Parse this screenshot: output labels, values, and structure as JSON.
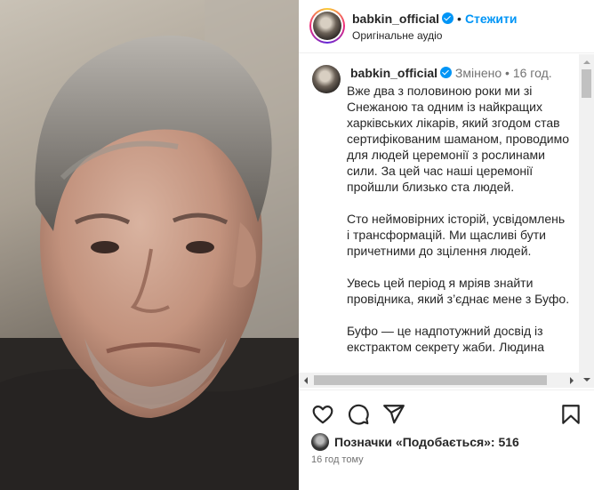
{
  "header": {
    "username": "babkin_official",
    "follow_label": "Стежити",
    "audio_label": "Оригінальне аудіо"
  },
  "caption": {
    "username": "babkin_official",
    "edited_label": "Змінено",
    "time": "16 год.",
    "text": "Вже два з половиною роки ми зі Снежаною та одним із найкращих харківських лікарів, який згодом став сертифікованим шаманом, проводимо для людей церемонії з рослинами сили. За цей час наші церемонії пройшли близько ста людей.\n\nСто неймовірних історій, усвідомлень і трансформацій. Ми щасливі бути причетними до зцілення людей.\n\nУвесь цей період я мріяв знайти провідника, який з’єднає мене з Буфо.\n\nБуфо — це надпотужний досвід із екстрактом секрету жаби. Людина"
  },
  "likes": {
    "text": "Позначки «Подобається»: 516"
  },
  "timestamp": "16 год тому",
  "colors": {
    "accent": "#0095f6",
    "text": "#262626",
    "muted": "#737373"
  }
}
